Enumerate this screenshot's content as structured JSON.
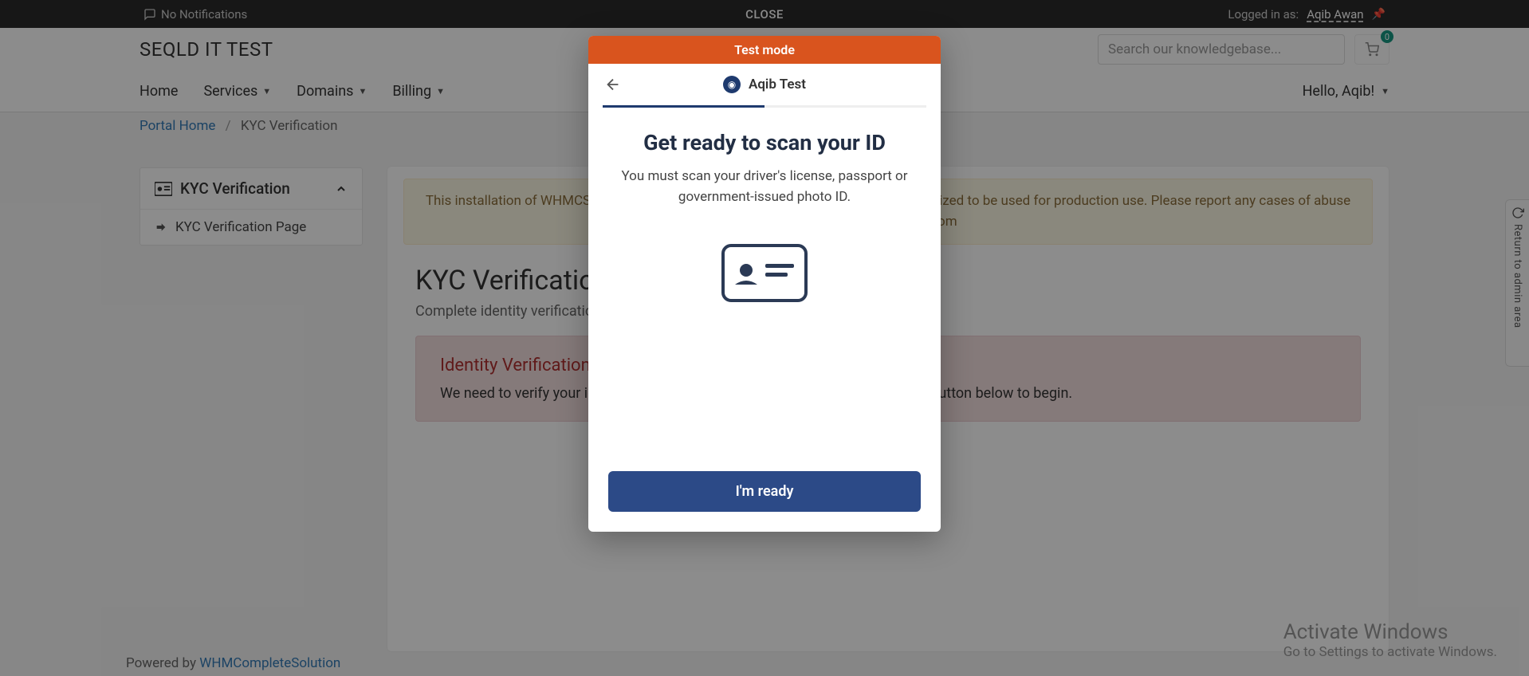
{
  "topbar": {
    "notifications": "No Notifications",
    "close": "CLOSE",
    "loggedInAs": "Logged in as:",
    "username": "Aqib Awan"
  },
  "header": {
    "brand": "SEQLD IT TEST",
    "searchPlaceholder": "Search our knowledgebase...",
    "cartCount": "0",
    "nav": {
      "home": "Home",
      "services": "Services",
      "domains": "Domains",
      "billing": "Billing",
      "hello": "Hello, Aqib!"
    }
  },
  "breadcrumb": {
    "home": "Portal Home",
    "sep": "/",
    "current": "KYC Verification"
  },
  "sidebar": {
    "title": "KYC Verification",
    "item": "KYC Verification Page"
  },
  "devBanner": "This installation of WHMCS is running under a Development License and is not authorized to be used for production use. Please report any cases of abuse to abuse@whmcs.com",
  "kyc": {
    "title": "KYC Verification",
    "subtitle": "Complete identity verification to secure your account.",
    "reqTitle": "Identity Verification Required",
    "reqBody": "We need to verify your identity before we can activate your account. Click the button below to begin."
  },
  "footer": {
    "poweredBy": "Powered by ",
    "link": "WHMCompleteSolution"
  },
  "activate": {
    "title": "Activate Windows",
    "sub": "Go to Settings to activate Windows."
  },
  "returnTab": "Return to admin area",
  "modal": {
    "mode": "Test mode",
    "account": "Aqib Test",
    "title": "Get ready to scan your ID",
    "body": "You must scan your driver's license, passport or government-issued photo ID.",
    "button": "I'm ready"
  }
}
